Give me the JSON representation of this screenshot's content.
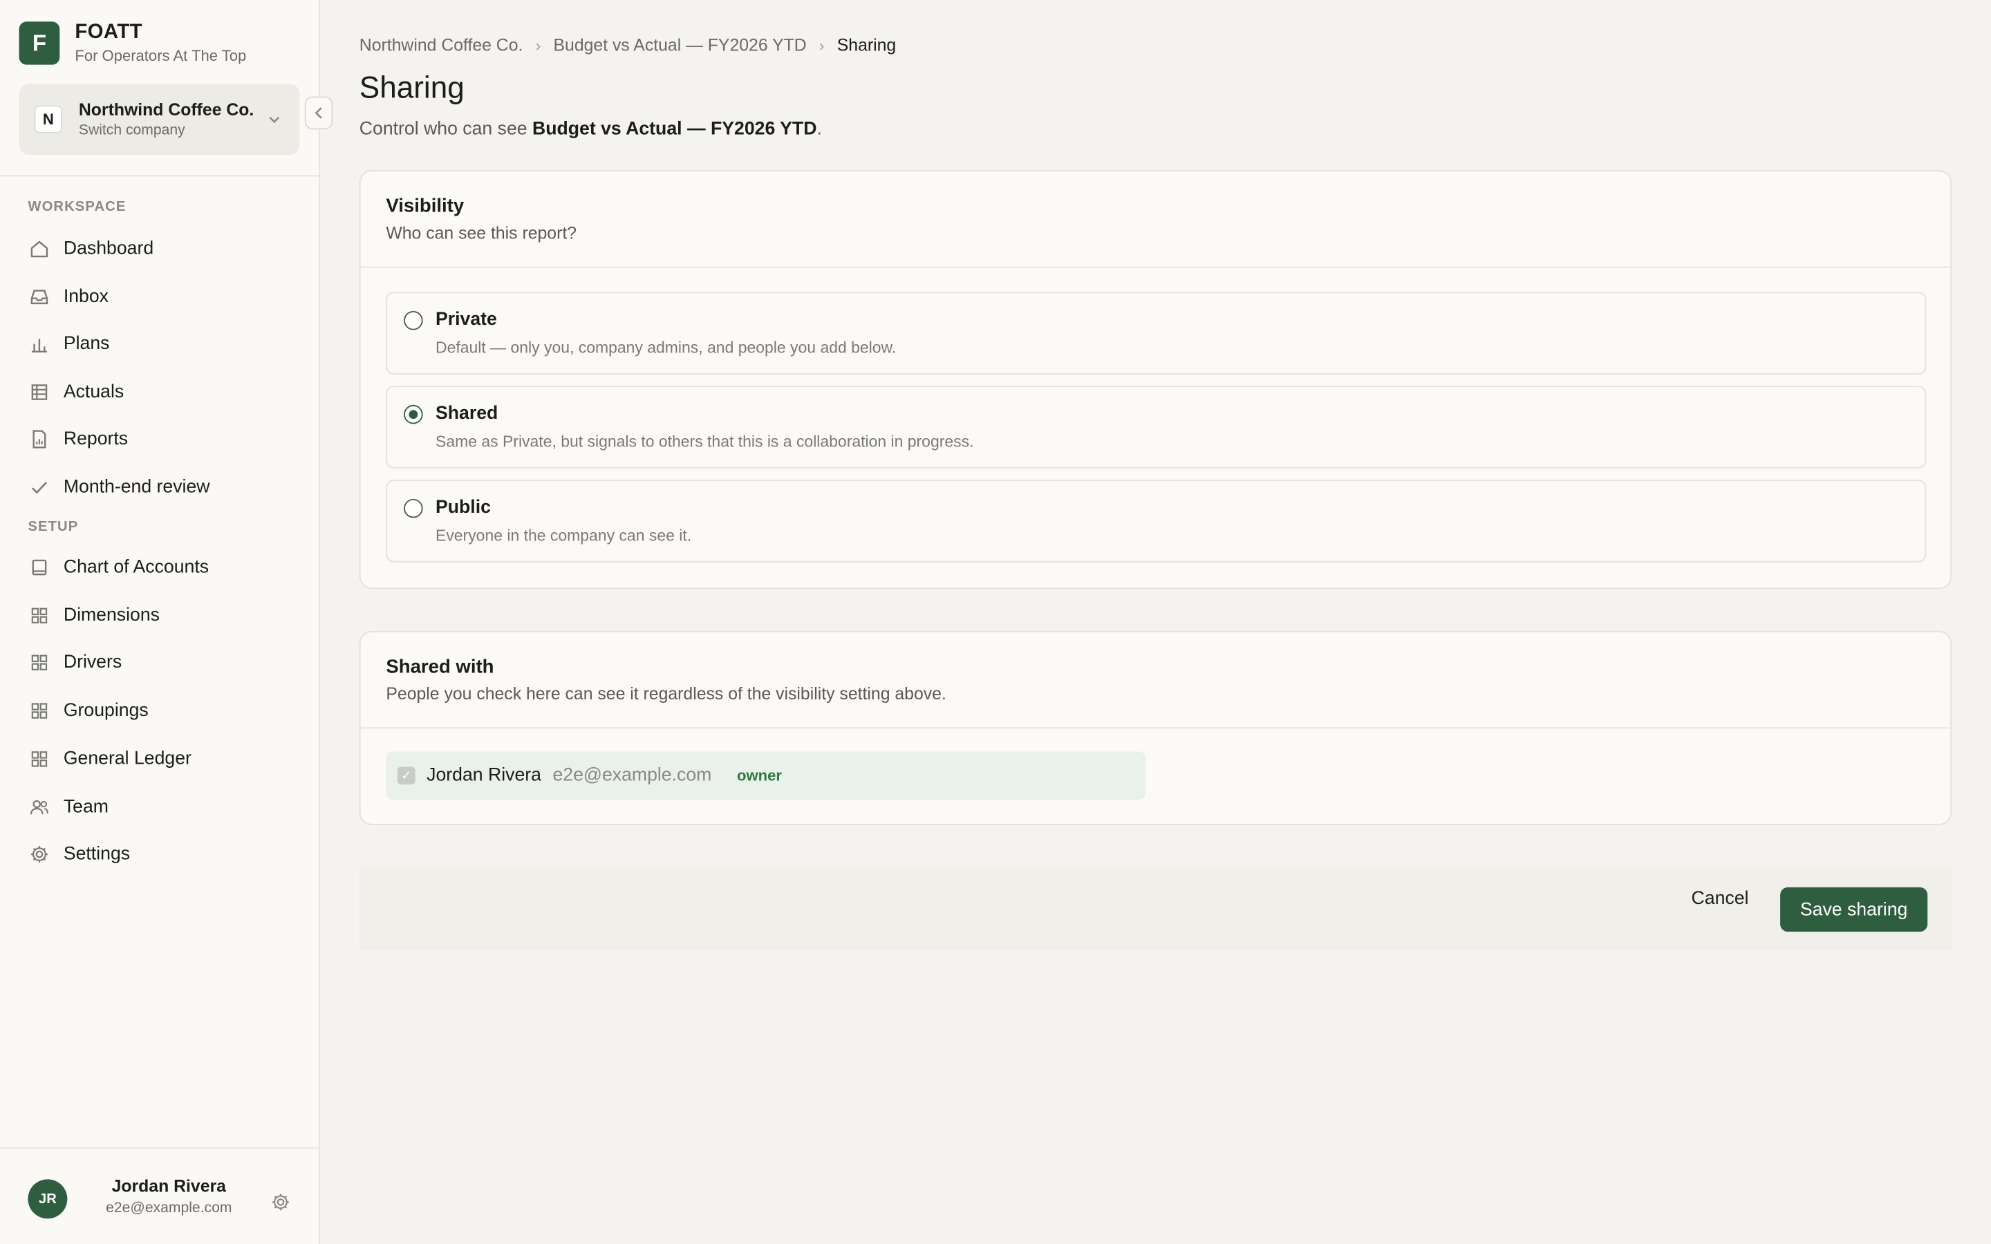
{
  "brand": {
    "name": "FOATT",
    "tagline": "For Operators At The Top",
    "logo_letter": "F"
  },
  "company": {
    "initial": "N",
    "name": "Northwind Coffee Co.",
    "sub": "Switch company"
  },
  "sidebar": {
    "workspace_label": "WORKSPACE",
    "setup_label": "SETUP",
    "workspace_items": [
      {
        "label": "Dashboard",
        "icon": "home-icon"
      },
      {
        "label": "Inbox",
        "icon": "inbox-icon"
      },
      {
        "label": "Plans",
        "icon": "bar-chart-icon"
      },
      {
        "label": "Actuals",
        "icon": "table-icon"
      },
      {
        "label": "Reports",
        "icon": "report-icon"
      },
      {
        "label": "Month-end review",
        "icon": "check-icon"
      }
    ],
    "setup_items": [
      {
        "label": "Chart of Accounts",
        "icon": "book-icon"
      },
      {
        "label": "Dimensions",
        "icon": "grid-icon"
      },
      {
        "label": "Drivers",
        "icon": "grid-icon"
      },
      {
        "label": "Groupings",
        "icon": "grid-icon"
      },
      {
        "label": "General Ledger",
        "icon": "grid-icon"
      },
      {
        "label": "Team",
        "icon": "users-icon"
      },
      {
        "label": "Settings",
        "icon": "gear-icon"
      }
    ]
  },
  "user": {
    "initials": "JR",
    "name": "Jordan Rivera",
    "email": "e2e@example.com"
  },
  "breadcrumb": [
    "Northwind Coffee Co.",
    "Budget vs Actual — FY2026 YTD",
    "Sharing"
  ],
  "page": {
    "title": "Sharing",
    "desc_prefix": "Control who can see ",
    "desc_report": "Budget vs Actual — FY2026 YTD",
    "desc_suffix": "."
  },
  "visibility": {
    "title": "Visibility",
    "subtitle": "Who can see this report?",
    "options": [
      {
        "title": "Private",
        "desc": "Default — only you, company admins, and people you add below.",
        "checked": false
      },
      {
        "title": "Shared",
        "desc": "Same as Private, but signals to others that this is a collaboration in progress.",
        "checked": true
      },
      {
        "title": "Public",
        "desc": "Everyone in the company can see it.",
        "checked": false
      }
    ]
  },
  "shared_with": {
    "title": "Shared with",
    "subtitle": "People you check here can see it regardless of the visibility setting above.",
    "people": [
      {
        "name": "Jordan Rivera",
        "email": "e2e@example.com",
        "role": "owner",
        "checked": true
      }
    ]
  },
  "actions": {
    "cancel": "Cancel",
    "save": "Save sharing"
  },
  "colors": {
    "accent": "#2f5d3f",
    "background": "#f4f3ef",
    "sidebar": "#faf9f6"
  }
}
